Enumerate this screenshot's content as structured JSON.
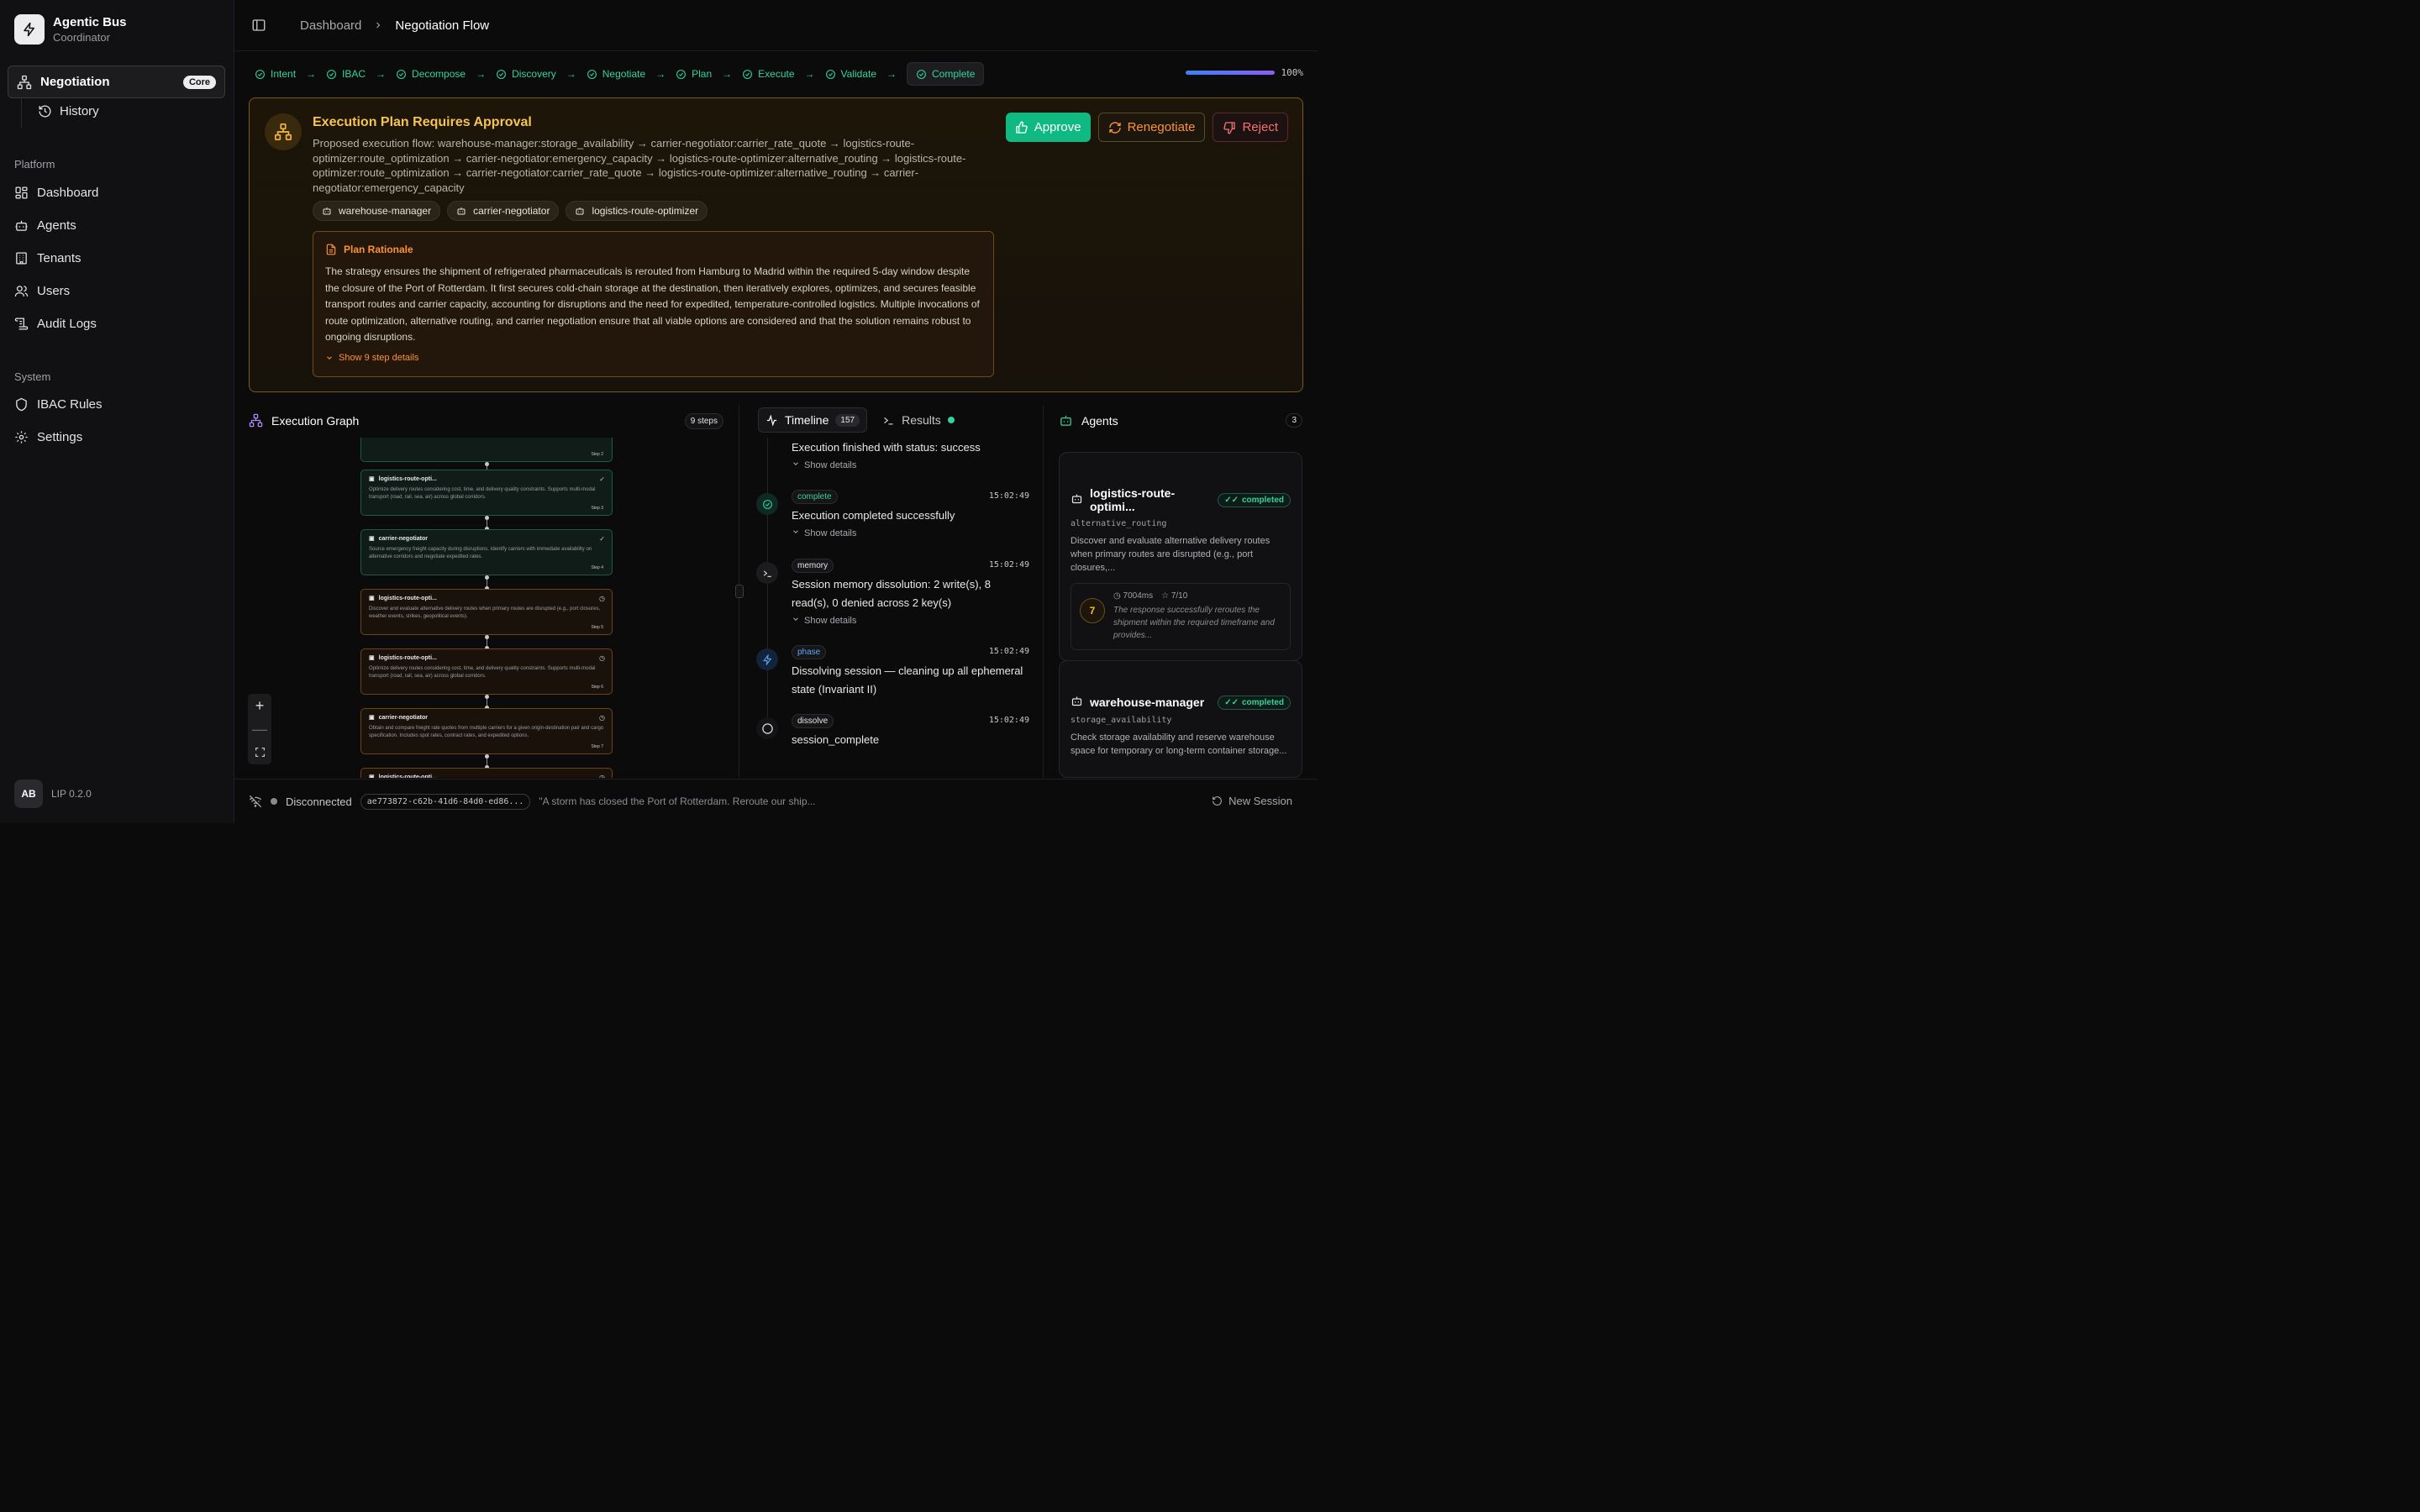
{
  "brand": {
    "title": "Agentic Bus",
    "subtitle": "Coordinator"
  },
  "sidebar": {
    "active_item": {
      "label": "Negotiation",
      "badge": "Core"
    },
    "sub_item": {
      "label": "History"
    },
    "platform_label": "Platform",
    "platform_items": [
      {
        "label": "Dashboard"
      },
      {
        "label": "Agents"
      },
      {
        "label": "Tenants"
      },
      {
        "label": "Users"
      },
      {
        "label": "Audit Logs"
      }
    ],
    "system_label": "System",
    "system_items": [
      {
        "label": "IBAC Rules"
      },
      {
        "label": "Settings"
      }
    ],
    "footer": {
      "avatar": "AB",
      "version": "LIP 0.2.0"
    }
  },
  "breadcrumb": {
    "parent": "Dashboard",
    "current": "Negotiation Flow"
  },
  "pipeline": {
    "steps": [
      "Intent",
      "IBAC",
      "Decompose",
      "Discovery",
      "Negotiate",
      "Plan",
      "Execute",
      "Validate",
      "Complete"
    ],
    "progress_label": "100%",
    "progress_value": 1.0
  },
  "approval": {
    "title": "Execution Plan Requires Approval",
    "description": "Proposed execution flow: warehouse-manager:storage_availability → carrier-negotiator:carrier_rate_quote → logistics-route-optimizer:route_optimization → carrier-negotiator:emergency_capacity → logistics-route-optimizer:alternative_routing → logistics-route-optimizer:route_optimization → carrier-negotiator:carrier_rate_quote → logistics-route-optimizer:alternative_routing → carrier-negotiator:emergency_capacity",
    "agents": [
      "warehouse-manager",
      "carrier-negotiator",
      "logistics-route-optimizer"
    ],
    "buttons": {
      "approve": "Approve",
      "renegotiate": "Renegotiate",
      "reject": "Reject"
    },
    "rationale": {
      "title": "Plan Rationale",
      "body": "The strategy ensures the shipment of refrigerated pharmaceuticals is rerouted from Hamburg to Madrid within the required 5-day window despite the closure of the Port of Rotterdam. It first secures cold-chain storage at the destination, then iteratively explores, optimizes, and secures feasible transport routes and carrier capacity, accounting for disruptions and the need for expedited, temperature-controlled logistics. Multiple invocations of route optimization, alternative routing, and carrier negotiation ensure that all viable options are considered and that the solution remains robust to ongoing disruptions.",
      "toggle": "Show 9 step details"
    }
  },
  "graph": {
    "title": "Execution Graph",
    "badge": "9 steps",
    "nodes": [
      {
        "name": "",
        "desc": "",
        "step": "Step 2",
        "status": "done"
      },
      {
        "name": "logistics-route-opti...",
        "desc": "Optimize delivery routes considering cost, time, and delivery quality constraints. Supports multi-modal transport (road, rail, sea, air) across global corridors.",
        "step": "Step 3",
        "status": "done"
      },
      {
        "name": "carrier-negotiator",
        "desc": "Source emergency freight capacity during disruptions. Identify carriers with immediate availability on alternative corridors and negotiate expedited rates.",
        "step": "Step 4",
        "status": "done"
      },
      {
        "name": "logistics-route-opti...",
        "desc": "Discover and evaluate alternative delivery routes when primary routes are disrupted (e.g., port closures, weather events, strikes, geopolitical events).",
        "step": "Step 5",
        "status": "pend"
      },
      {
        "name": "logistics-route-opti...",
        "desc": "Optimize delivery routes considering cost, time, and delivery quality constraints. Supports multi-modal transport (road, rail, sea, air) across global corridors.",
        "step": "Step 6",
        "status": "pend"
      },
      {
        "name": "carrier-negotiator",
        "desc": "Obtain and compare freight rate quotes from multiple carriers for a given origin-destination pair and cargo specification. Includes spot rates, contract rates, and expedited options.",
        "step": "Step 7",
        "status": "pend"
      },
      {
        "name": "logistics-route-opti...",
        "desc": "",
        "step": "",
        "status": "pend"
      }
    ]
  },
  "timeline": {
    "tab_label": "Timeline",
    "count": "157",
    "results_label": "Results",
    "items": [
      {
        "tag": "",
        "time": "",
        "msg": "Execution finished with status: success",
        "more": "Show details"
      },
      {
        "tag": "complete",
        "time": "15:02:49",
        "msg": "Execution completed successfully",
        "more": "Show details"
      },
      {
        "tag": "memory",
        "time": "15:02:49",
        "msg": "Session memory dissolution: 2 write(s), 8 read(s), 0 denied across 2 key(s)",
        "more": "Show details"
      },
      {
        "tag": "phase",
        "time": "15:02:49",
        "msg": "Dissolving session — cleaning up all ephemeral state (Invariant II)",
        "more": ""
      },
      {
        "tag": "dissolve",
        "time": "15:02:49",
        "msg": "session_complete",
        "more": ""
      }
    ]
  },
  "agents": {
    "title": "Agents",
    "count": "3",
    "cards": [
      {
        "name": "logistics-route-optimi...",
        "status": "completed",
        "capability": "alternative_routing",
        "desc": "Discover and evaluate alternative delivery routes when primary routes are disrupted (e.g., port closures,...",
        "score": "7",
        "latency": "7004ms",
        "rating": "7/10",
        "eval": "The response successfully reroutes the shipment within the required timeframe and provides..."
      },
      {
        "name": "warehouse-manager",
        "status": "completed",
        "capability": "storage_availability",
        "desc": "Check storage availability and reserve warehouse space for temporary or long-term container storage..."
      }
    ]
  },
  "statusbar": {
    "connection": "Disconnected",
    "session_id": "ae773872-c62b-41d6-84d0-ed86...",
    "prompt": "\"A storm has closed the Port of Rotterdam. Reroute our ship...",
    "new_session": "New Session"
  }
}
